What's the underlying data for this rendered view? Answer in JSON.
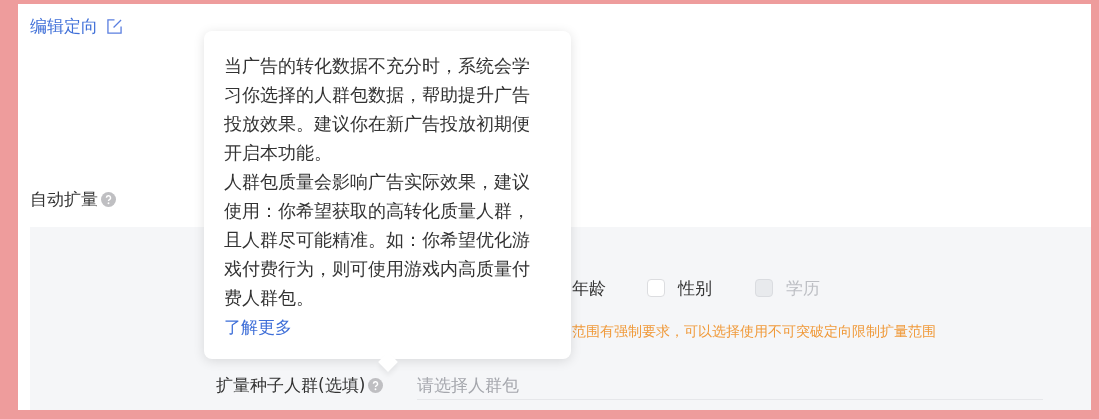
{
  "edit_link": {
    "label": "编辑定向"
  },
  "auto_expand": {
    "label": "自动扩量"
  },
  "partial_option_label": "年龄",
  "expand_options": [
    {
      "label": "性别",
      "checked": false,
      "disabled": false
    },
    {
      "label": "学历",
      "checked": false,
      "disabled": true
    }
  ],
  "warning": "范围有强制要求，可以选择使用不可突破定向限制扩量范围",
  "seed_audience": {
    "label": "扩量种子人群(选填)",
    "placeholder": "请选择人群包"
  },
  "tooltip": {
    "paragraphs": [
      "当广告的转化数据不充分时，系统会学习你选择的人群包数据，帮助提升广告投放效果。建议你在新广告投放初期便开启本功能。",
      "人群包质量会影响广告实际效果，建议使用：你希望获取的高转化质量人群，且人群尽可能精准。如：你希望优化游戏付费行为，则可使用游戏内高质量付费人群包。"
    ],
    "link": "了解更多"
  }
}
